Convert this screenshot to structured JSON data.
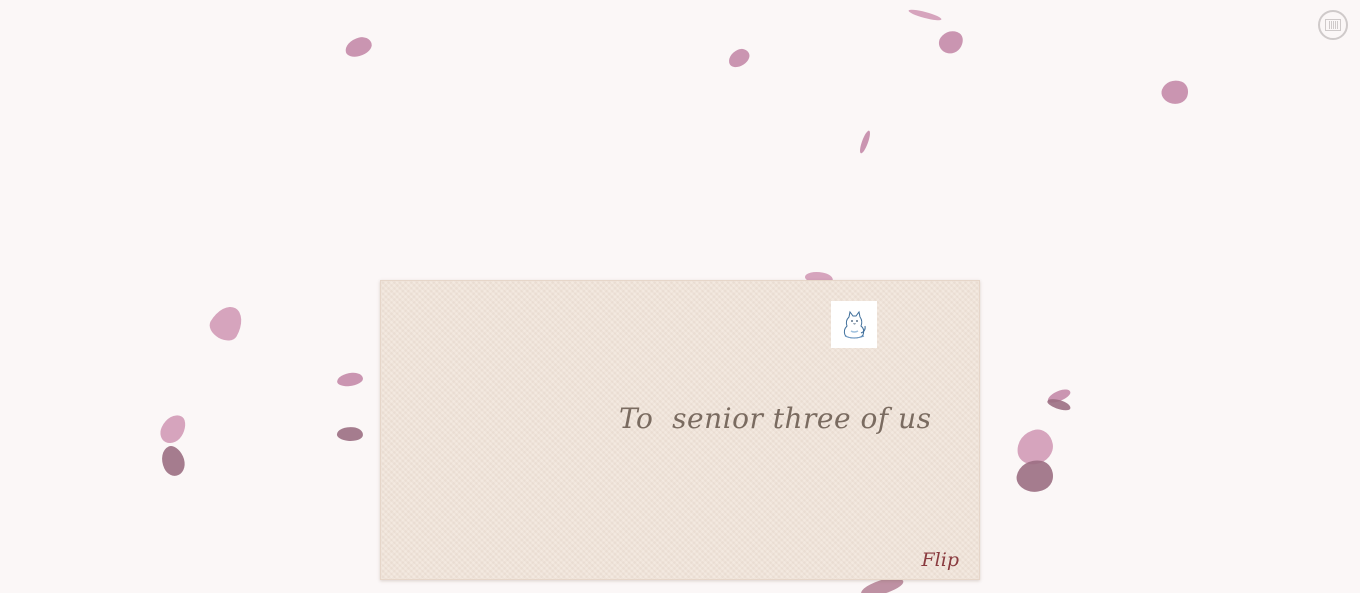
{
  "envelope": {
    "recipient_text": "To  senior three of us",
    "flip_label": "Flip",
    "stamp_icon": "kitten-stamp-icon"
  },
  "controls": {
    "music_icon": "music-toggle-icon"
  },
  "colors": {
    "background": "#fbf7f7",
    "envelope": "#f0e3d8",
    "recipient_text": "#7a6b60",
    "flip_text": "#8a3b3f",
    "petal_light": "#d19ab6",
    "petal_dark": "#9b6e82"
  }
}
